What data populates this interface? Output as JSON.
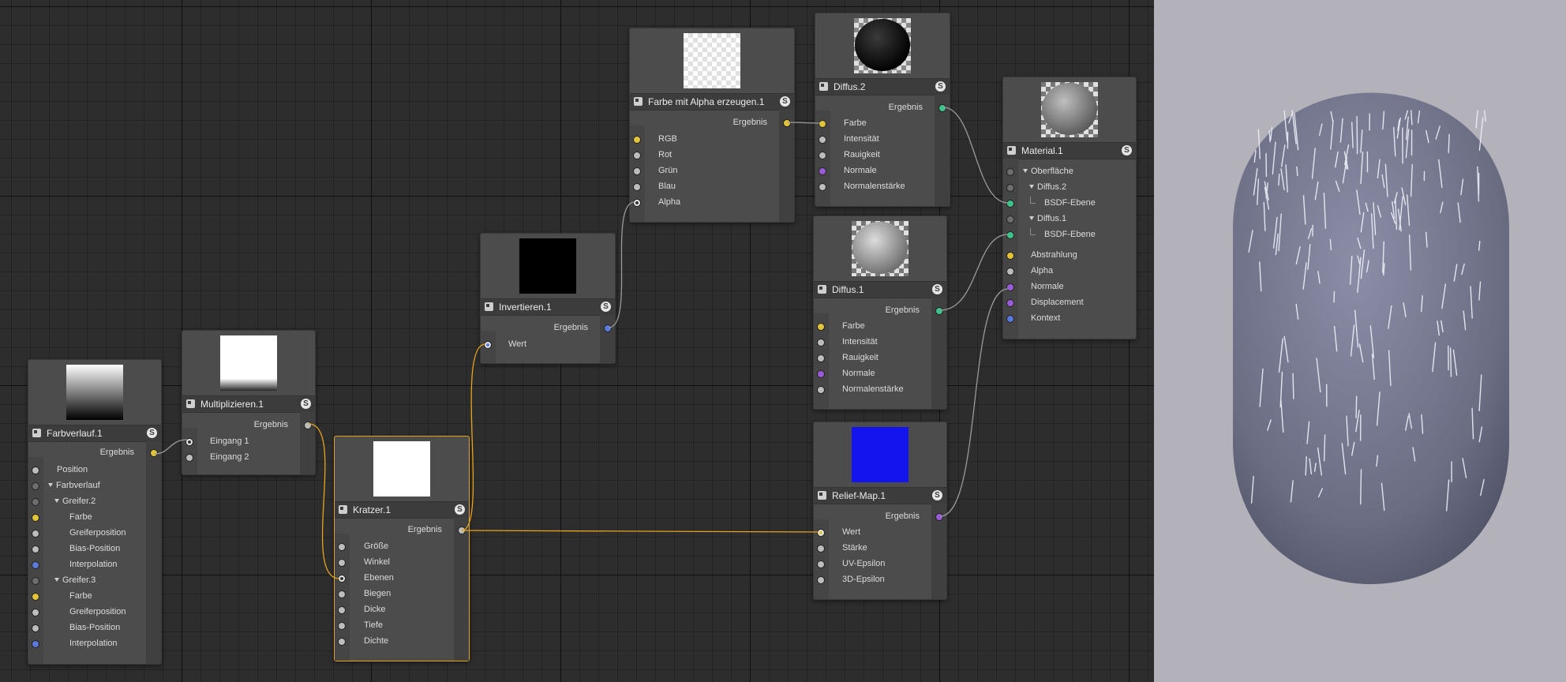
{
  "nodes": {
    "farbverlauf": {
      "title": "Farbverlauf.1",
      "output": "Ergebnis",
      "inputs": [
        "Position",
        "Farbverlauf",
        "Greifer.2",
        "Farbe",
        "Greiferposition",
        "Bias-Position",
        "Interpolation",
        "Greifer.3",
        "Farbe",
        "Greiferposition",
        "Bias-Position",
        "Interpolation"
      ]
    },
    "multiplizieren": {
      "title": "Multiplizieren.1",
      "output": "Ergebnis",
      "inputs": [
        "Eingang 1",
        "Eingang 2"
      ]
    },
    "kratzer": {
      "title": "Kratzer.1",
      "output": "Ergebnis",
      "inputs": [
        "Größe",
        "Winkel",
        "Ebenen",
        "Biegen",
        "Dicke",
        "Tiefe",
        "Dichte"
      ]
    },
    "invertieren": {
      "title": "Invertieren.1",
      "output": "Ergebnis",
      "inputs": [
        "Wert"
      ]
    },
    "farbe_alpha": {
      "title": "Farbe mit Alpha erzeugen.1",
      "output": "Ergebnis",
      "inputs": [
        "RGB",
        "Rot",
        "Grün",
        "Blau",
        "Alpha"
      ]
    },
    "diffus2": {
      "title": "Diffus.2",
      "output": "Ergebnis",
      "inputs": [
        "Farbe",
        "Intensität",
        "Rauigkeit",
        "Normale",
        "Normalenstärke"
      ]
    },
    "diffus1": {
      "title": "Diffus.1",
      "output": "Ergebnis",
      "inputs": [
        "Farbe",
        "Intensität",
        "Rauigkeit",
        "Normale",
        "Normalenstärke"
      ]
    },
    "reliefmap": {
      "title": "Relief-Map.1",
      "output": "Ergebnis",
      "inputs": [
        "Wert",
        "Stärke",
        "UV-Epsilon",
        "3D-Epsilon"
      ]
    },
    "material": {
      "title": "Material.1",
      "inputs": [
        "Oberfläche",
        "Diffus.2",
        "BSDF-Ebene",
        "Diffus.1",
        "BSDF-Ebene",
        "Abstrahlung",
        "Alpha",
        "Normale",
        "Displacement",
        "Kontext"
      ]
    }
  },
  "badge": "S",
  "colors": {
    "wire_gray": "#9a9a9a",
    "wire_selected": "#e7a41e",
    "port_yellow": "#e2c43a",
    "port_green": "#3ec48b",
    "port_blue": "#5b79d8",
    "port_purple": "#9a5bd8",
    "viewport_background": "#b3b1b9"
  }
}
